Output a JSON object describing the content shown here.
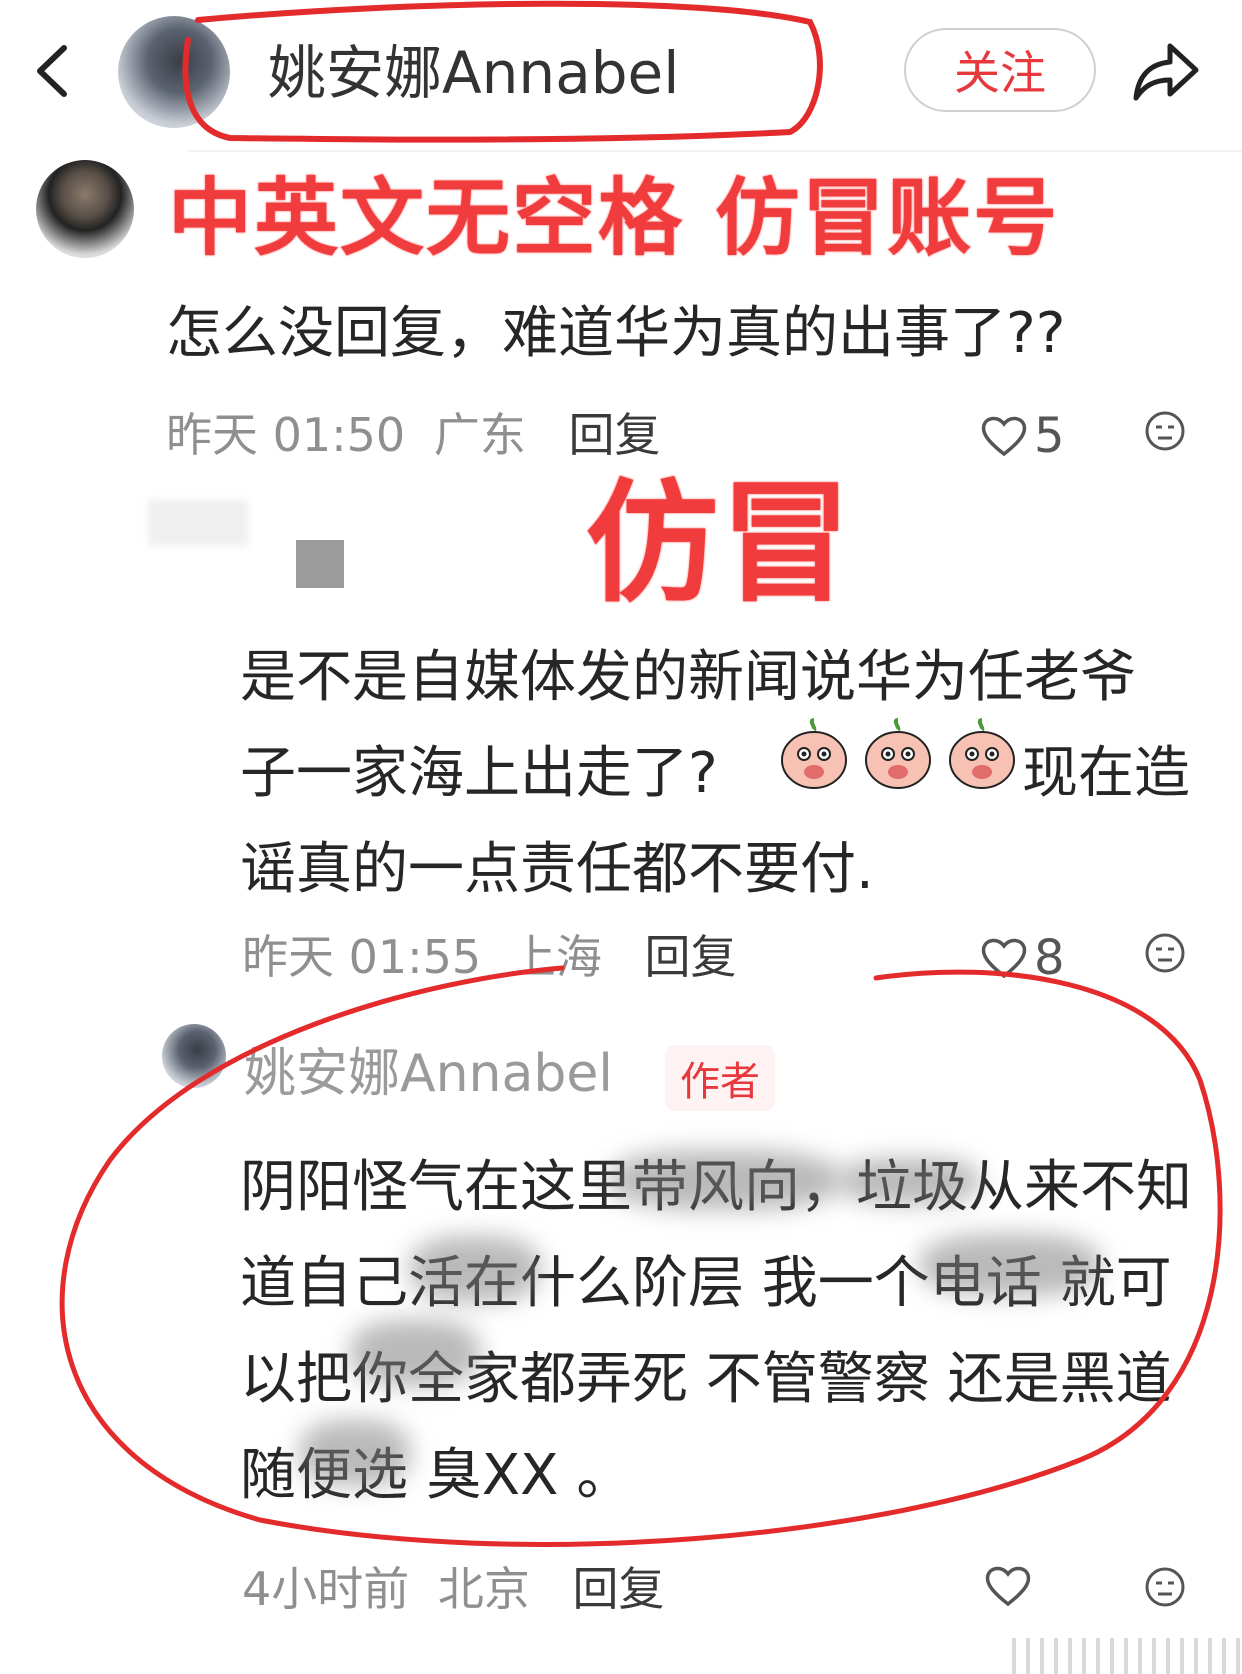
{
  "header": {
    "back_icon": "chevron-left-icon",
    "username": "姚安娜Annabel",
    "follow_label": "关注",
    "share_icon": "share-arrow-icon"
  },
  "annotations": {
    "stamp1": "中英文无空格 仿冒账号",
    "stamp2": "仿冒"
  },
  "comments": [
    {
      "text": "怎么没回复，难道华为真的出事了??",
      "time": "昨天 01:50",
      "location": "广东",
      "reply_label": "回复",
      "likes": "5"
    },
    {
      "lines": [
        "是不是自媒体发的新闻说华为任老爷",
        "子一家海上出走了?",
        "现在造",
        "谣真的一点责任都不要付."
      ],
      "time": "昨天 01:55",
      "location": "上海",
      "reply_label": "回复",
      "likes": "8"
    },
    {
      "username": "姚安娜Annabel",
      "author_tag": "作者",
      "lines": [
        "阴阳怪气在这里带风向，垃圾从来不知",
        "道自己活在什么阶层 我一个电话 就可",
        "以把你全家都弄死 不管警察 还是黑道",
        "随便选 臭XX 。"
      ],
      "time": "4小时前",
      "location": "北京",
      "reply_label": "回复",
      "likes": ""
    }
  ],
  "colors": {
    "accent": "#e7383d",
    "annotation_red": "#e32b2b",
    "meta_gray": "#8f8f8f"
  }
}
